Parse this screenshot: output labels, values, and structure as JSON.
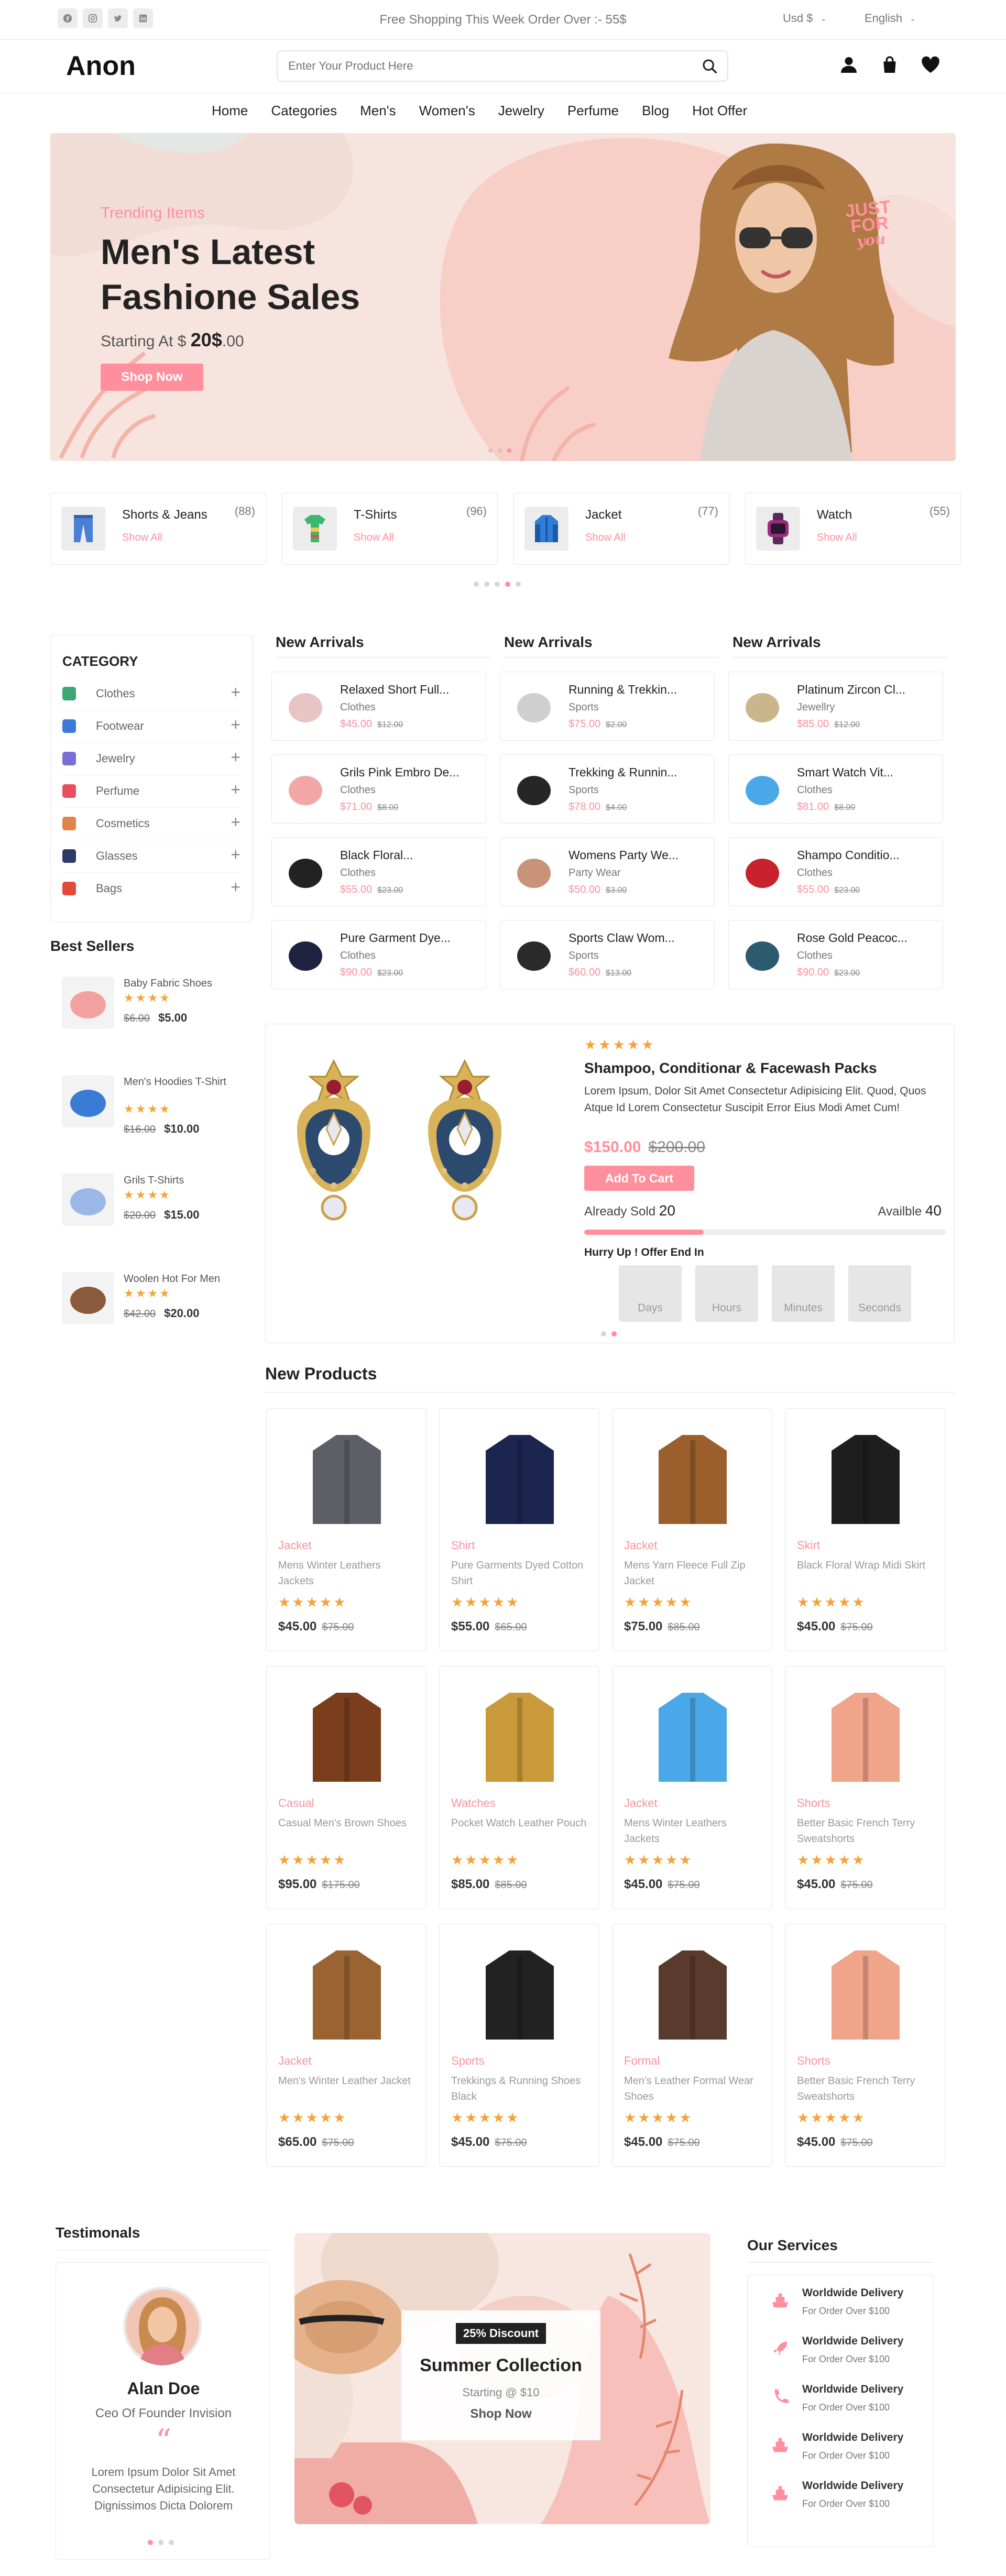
{
  "topbar": {
    "promo": "Free Shopping This Week Order Over :- 55$",
    "currency": "Usd $",
    "language": "English",
    "social": [
      "facebook-icon",
      "instagram-icon",
      "twitter-icon",
      "linkedin-icon"
    ]
  },
  "header": {
    "logo": "Anon",
    "search_placeholder": "Enter Your Product Here"
  },
  "nav": [
    "Home",
    "Categories",
    "Men's",
    "Women's",
    "Jewelry",
    "Perfume",
    "Blog",
    "Hot Offer"
  ],
  "hero": {
    "subtitle": "Trending Items",
    "title_line1": "Men's Latest",
    "title_line2": "Fashione Sales",
    "price_prefix": "Starting At $ ",
    "price_main": "20$",
    "price_suffix": ".00",
    "button": "Shop Now",
    "badge_line1": "JUST",
    "badge_line2": "FOR",
    "badge_line3": "you"
  },
  "categories": [
    {
      "name": "Shorts & Jeans",
      "count": "(88)",
      "link": "Show All",
      "color": "#4a7fd4"
    },
    {
      "name": "T-Shirts",
      "count": "(96)",
      "link": "Show All",
      "color": "#39b86e"
    },
    {
      "name": "Jacket",
      "count": "(77)",
      "link": "Show All",
      "color": "#2f7ed8"
    },
    {
      "name": "Watch",
      "count": "(55)",
      "link": "Show All",
      "color": "#9b2d7e"
    }
  ],
  "sidebar": {
    "title": "CATEGORY",
    "items": [
      {
        "label": "Clothes",
        "color": "#3aa775"
      },
      {
        "label": "Footwear",
        "color": "#3b7bd5"
      },
      {
        "label": "Jewelry",
        "color": "#7a6ed8"
      },
      {
        "label": "Perfume",
        "color": "#e84f5e"
      },
      {
        "label": "Cosmetics",
        "color": "#e0844a"
      },
      {
        "label": "Glasses",
        "color": "#2b3a66"
      },
      {
        "label": "Bags",
        "color": "#e34a3a"
      }
    ]
  },
  "bestsellers": {
    "title": "Best Sellers",
    "items": [
      {
        "name": "Baby Fabric Shoes",
        "old": "$6.00",
        "price": "$5.00",
        "color": "#f3a0a0"
      },
      {
        "name": "Men's Hoodies T-Shirt",
        "old": "$16.00",
        "price": "$10.00",
        "color": "#3a7bd5"
      },
      {
        "name": "Grils T-Shirts",
        "old": "$20.00",
        "price": "$15.00",
        "color": "#9bb7e8"
      },
      {
        "name": "Woolen Hot For Men",
        "old": "$42.00",
        "price": "$20.00",
        "color": "#8b5a3c"
      }
    ]
  },
  "arrivals": [
    {
      "title": "New Arrivals",
      "items": [
        {
          "name": "Relaxed Short Full...",
          "cat": "Clothes",
          "price": "$45.00",
          "old": "$12.00",
          "color": "#e9c4c4"
        },
        {
          "name": "Grils Pink Embro De...",
          "cat": "Clothes",
          "price": "$71.00",
          "old": "$8.00",
          "color": "#f2a7a7"
        },
        {
          "name": "Black Floral...",
          "cat": "Clothes",
          "price": "$55.00",
          "old": "$23.00",
          "color": "#222222"
        },
        {
          "name": "Pure Garment Dye...",
          "cat": "Clothes",
          "price": "$90.00",
          "old": "$23.00",
          "color": "#1d2340"
        }
      ]
    },
    {
      "title": "New Arrivals",
      "items": [
        {
          "name": "Running & Trekkin...",
          "cat": "Sports",
          "price": "$75.00",
          "old": "$2.00",
          "color": "#cfcfcf"
        },
        {
          "name": "Trekking & Runnin...",
          "cat": "Sports",
          "price": "$78.00",
          "old": "$4.00",
          "color": "#262626"
        },
        {
          "name": "Womens Party We...",
          "cat": "Party Wear",
          "price": "$50.00",
          "old": "$3.00",
          "color": "#c9937a"
        },
        {
          "name": "Sports Claw Wom...",
          "cat": "Sports",
          "price": "$60.00",
          "old": "$13.00",
          "color": "#2a2a2a"
        }
      ]
    },
    {
      "title": "New Arrivals",
      "items": [
        {
          "name": "Platinum Zircon Cl...",
          "cat": "Jewellry",
          "price": "$85.00",
          "old": "$12.00",
          "color": "#c9b68a"
        },
        {
          "name": "Smart Watch Vit...",
          "cat": "Clothes",
          "price": "$81.00",
          "old": "$8.00",
          "color": "#4aa8e8"
        },
        {
          "name": "Shampo Conditio...",
          "cat": "Clothes",
          "price": "$55.00",
          "old": "$23.00",
          "color": "#c8232c"
        },
        {
          "name": "Rose Gold Peacoc...",
          "cat": "Clothes",
          "price": "$90.00",
          "old": "$23.00",
          "color": "#2c5a6e"
        }
      ]
    }
  ],
  "deal": {
    "stars": "★★★★★",
    "title": "Shampoo, Conditionar & Facewash Packs",
    "desc": "Lorem Ipsum, Dolor Sit Amet Consectetur Adipisicing Elit. Quod, Quos Atque Id Lorem Consectetur Suscipit Error Eius Modi Amet Cum!",
    "price": "$150.00",
    "old": "$200.00",
    "button": "Add To Cart",
    "sold_label": "Already Sold",
    "sold": "20",
    "avail_label": "Availble",
    "avail": "40",
    "sold_fraction": 0.33,
    "timer_label": "Hurry Up ! Offer End In",
    "timer": [
      "Days",
      "Hours",
      "Minutes",
      "Seconds"
    ]
  },
  "products": {
    "title": "New Products",
    "items": [
      {
        "cat": "Jacket",
        "name": "Mens Winter Leathers Jackets",
        "price": "$45.00",
        "old": "$75.00",
        "color": "#5c6066"
      },
      {
        "cat": "Shirt",
        "name": "Pure Garments Dyed Cotton Shirt",
        "price": "$55.00",
        "old": "$65.00",
        "color": "#1b2550"
      },
      {
        "cat": "Jacket",
        "name": "Mens Yarn Fleece Full Zip Jacket",
        "price": "$75.00",
        "old": "$85.00",
        "color": "#9a5f2c"
      },
      {
        "cat": "Skirt",
        "name": "Black Floral Wrap Midi Skirt",
        "price": "$45.00",
        "old": "$75.00",
        "color": "#1e1e1e"
      },
      {
        "cat": "Casual",
        "name": "Casual Men's Brown Shoes",
        "price": "$95.00",
        "old": "$175.00",
        "color": "#7a3e1c"
      },
      {
        "cat": "Watches",
        "name": "Pocket Watch Leather Pouch",
        "price": "$85.00",
        "old": "$85.00",
        "color": "#c89a3a"
      },
      {
        "cat": "Jacket",
        "name": "Mens Winter Leathers Jackets",
        "price": "$45.00",
        "old": "$75.00",
        "color": "#4aa8e8"
      },
      {
        "cat": "Shorts",
        "name": "Better Basic French Terry Sweatshorts",
        "price": "$45.00",
        "old": "$75.00",
        "color": "#f0a48a"
      },
      {
        "cat": "Jacket",
        "name": "Men's Winter Leather Jacket",
        "price": "$65.00",
        "old": "$75.00",
        "color": "#9a6432"
      },
      {
        "cat": "Sports",
        "name": "Trekkings & Running Shoes Black",
        "price": "$45.00",
        "old": "$75.00",
        "color": "#222222"
      },
      {
        "cat": "Formal",
        "name": "Men's Leather Formal Wear Shoes",
        "price": "$45.00",
        "old": "$75.00",
        "color": "#5a3a2c"
      },
      {
        "cat": "Shorts",
        "name": "Better Basic French Terry Sweatshorts",
        "price": "$45.00",
        "old": "$75.00",
        "color": "#f0a48a"
      }
    ]
  },
  "testimonial": {
    "title": "Testimonals",
    "name": "Alan Doe",
    "role": "Ceo Of Founder Invision",
    "quote": "Lorem Ipsum Dolor Sit Amet Consectetur Adipisicing Elit. Dignissimos Dicta Dolorem"
  },
  "promo": {
    "badge": "25% Discount",
    "title": "Summer Collection",
    "starting": "Starting @ $10",
    "link": "Shop Now"
  },
  "services": {
    "title": "Our Services",
    "items": [
      {
        "title": "Worldwide Delivery",
        "sub": "For Order Over $100",
        "icon": "ship-icon"
      },
      {
        "title": "Worldwide Delivery",
        "sub": "For Order Over $100",
        "icon": "rocket-icon"
      },
      {
        "title": "Worldwide Delivery",
        "sub": "For Order Over $100",
        "icon": "phone-icon"
      },
      {
        "title": "Worldwide Delivery",
        "sub": "For Order Over $100",
        "icon": "ship-icon"
      },
      {
        "title": "Worldwide Delivery",
        "sub": "For Order Over $100",
        "icon": "ship-icon"
      }
    ]
  }
}
